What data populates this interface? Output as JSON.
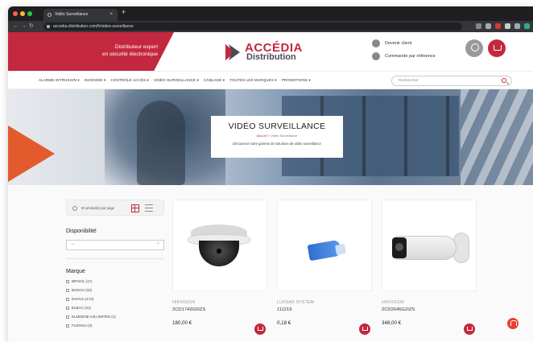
{
  "browser": {
    "tab_title": "Vidéo Surveillance",
    "new_tab": "+",
    "close_tab": "×",
    "url": "accedia-distribution.com/fr/video-surveillance"
  },
  "header": {
    "tagline_line1": "Distributeur expert",
    "tagline_line2": "en sécurité électronique",
    "logo_top": "ACCÉDIA",
    "logo_bottom": "Distribution",
    "become_client": "Devenir client",
    "order_by_ref": "Commande par référence",
    "brand_color": "#c4283e"
  },
  "menu": {
    "items": [
      "ALARME INTRUSION ▾",
      "INCENDIE ▾",
      "CONTRÔLE ACCÈS ▾",
      "VIDÉO SURVEILLANCE ▾",
      "CÂBLAGE ▾",
      "TOUTES LES MARQUES ▾",
      "PROMOTIONS ▾"
    ],
    "search_placeholder": "Rechercher"
  },
  "hero": {
    "title": "VIDÉO SURVEILLANCE",
    "crumb_home": "Accueil",
    "crumb_sep": " > ",
    "crumb_current": "Vidéo Surveillance",
    "description": "Découvrez notre gamme de solutions de vidéo surveillance"
  },
  "sidebar": {
    "per_page": "50 produit(s) par page",
    "availability_title": "Disponibilité",
    "availability_value": "---",
    "brand_title": "Marque",
    "brands": [
      "BIPSOL (17)",
      "BOSCH (32)",
      "DAHUA (172)",
      "ELBAC (31)",
      "ELMDENE Intl.LIMITED (4)",
      "FUZHOU (3)"
    ]
  },
  "products": [
    {
      "brand": "HIKVISION",
      "ref": "2CD1743G0IZS",
      "price": "180,00 €"
    },
    {
      "brand": "LUXSAR SYSTEM",
      "ref": "111219",
      "price": "0,18 €"
    },
    {
      "brand": "HIKVISION",
      "ref": "2CD2646G2IZS",
      "price": "348,00 €"
    }
  ]
}
